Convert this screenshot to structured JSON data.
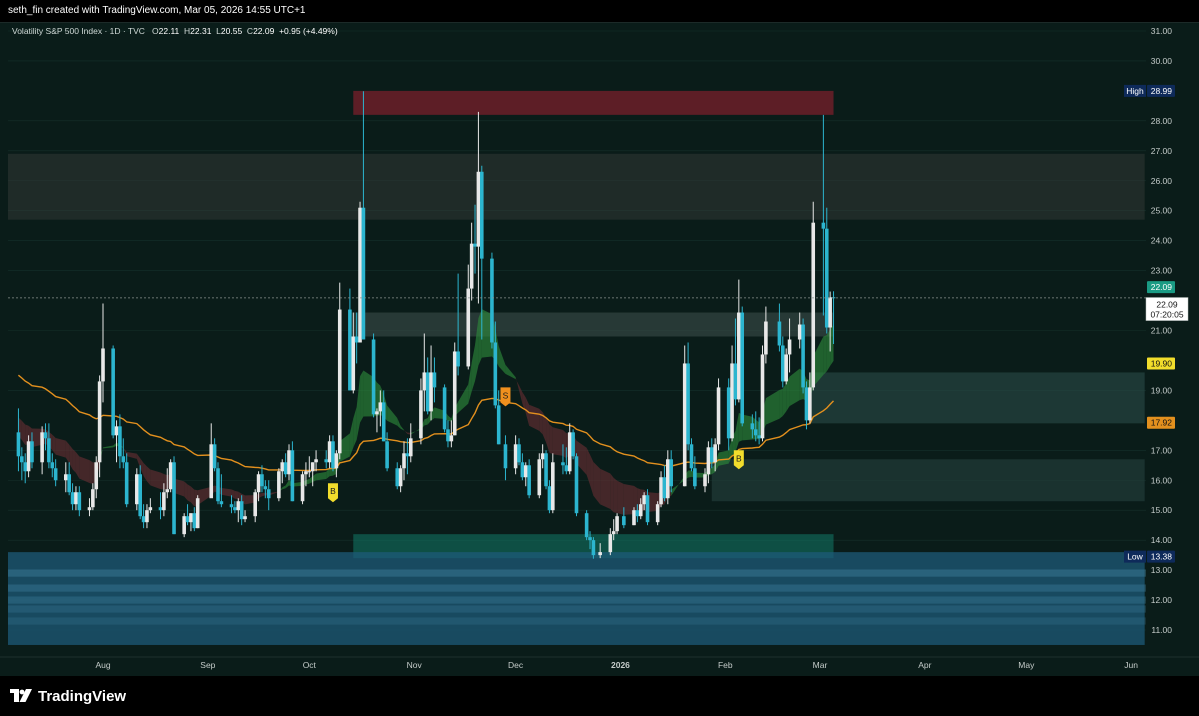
{
  "header": {
    "attribution": "seth_fin created with TradingView.com, Mar 05, 2026 14:55 UTC+1"
  },
  "legend": {
    "symbol": "Volatility S&P 500 Index · 1D · TVC",
    "o_label": "O",
    "o_value": "22.11",
    "h_label": "H",
    "h_value": "22.31",
    "l_label": "L",
    "l_value": "20.55",
    "c_label": "C",
    "c_value": "22.09",
    "change": "+0.95 (+4.49%)"
  },
  "branding": {
    "logo_text": "TradingView",
    "logo_icon": "tradingview-logo-icon"
  },
  "colors": {
    "background": "#0a1c19",
    "up_candle": "#e8e8e8",
    "down_candle": "#2cb5cf",
    "ema": "#e3901e",
    "grid": "#15302b"
  },
  "chart_data": {
    "type": "candlestick",
    "ylim": [
      10.5,
      31.5
    ],
    "y_ticks": [
      "31.00",
      "30.00",
      "28.00",
      "27.00",
      "26.00",
      "25.00",
      "24.00",
      "23.00",
      "21.00",
      "19.00",
      "17.00",
      "16.00",
      "15.00",
      "14.00",
      "13.00",
      "12.00",
      "11.00"
    ],
    "x_ticks": [
      "Aug",
      "Sep",
      "Oct",
      "Nov",
      "Dec",
      "2026",
      "Feb",
      "Mar",
      "Apr",
      "May",
      "Jun"
    ],
    "price_labels": {
      "high_label": "High",
      "high_value": "28.99",
      "low_label": "Low",
      "low_value": "13.38",
      "last_value": "22.09",
      "last_value_2": "22.09",
      "countdown": "07:20:05",
      "upper_band": "19.90",
      "ema_value": "17.92"
    },
    "signals": [
      {
        "text": "B",
        "x": "2025-10-08",
        "y": 15.6
      },
      {
        "text": "S",
        "x": "2025-11-28",
        "y": 18.8
      },
      {
        "text": "B",
        "x": "2026-02-05",
        "y": 16.7
      }
    ],
    "zones": [
      {
        "name": "supply-zone",
        "x_start": "2025-10-14",
        "x_end": "2026-03-05",
        "y_low": 28.2,
        "y_high": 29.0
      },
      {
        "name": "resistance-band",
        "x_start": "2025-06-24",
        "x_end": "2026-06-05",
        "y_low": 24.7,
        "y_high": 26.9
      },
      {
        "name": "mid-zone",
        "x_start": "2025-10-14",
        "x_end": "2026-03-05",
        "y_low": 20.8,
        "y_high": 21.6
      },
      {
        "name": "upper-demand-zone",
        "x_start": "2026-02-26",
        "x_end": "2026-06-05",
        "y_low": 17.9,
        "y_high": 19.6
      },
      {
        "name": "lower-demand-zone",
        "x_start": "2026-01-28",
        "x_end": "2026-06-05",
        "y_low": 15.3,
        "y_high": 16.7
      },
      {
        "name": "base-zone",
        "x_start": "2025-10-14",
        "x_end": "2026-03-05",
        "y_low": 13.4,
        "y_high": 14.2
      },
      {
        "name": "deep-band",
        "x_start": "2025-06-24",
        "x_end": "2026-06-05",
        "y_low": 10.5,
        "y_high": 13.6
      }
    ],
    "ohlc": [
      [
        "2025-07-07",
        17.6,
        18.4,
        16.3,
        16.8
      ],
      [
        "2025-07-08",
        16.8,
        17.1,
        16.0,
        16.6
      ],
      [
        "2025-07-09",
        16.6,
        16.9,
        15.9,
        16.3
      ],
      [
        "2025-07-10",
        16.3,
        17.5,
        16.1,
        17.3
      ],
      [
        "2025-07-11",
        17.3,
        17.6,
        16.4,
        16.6
      ],
      [
        "2025-07-14",
        16.6,
        17.8,
        16.2,
        17.6
      ],
      [
        "2025-07-15",
        17.6,
        17.9,
        17.0,
        17.4
      ],
      [
        "2025-07-16",
        17.4,
        17.9,
        16.4,
        16.6
      ],
      [
        "2025-07-17",
        16.6,
        16.9,
        16.1,
        16.4
      ],
      [
        "2025-07-18",
        16.4,
        16.7,
        15.8,
        16.0
      ],
      [
        "2025-07-21",
        16.0,
        16.6,
        15.6,
        16.2
      ],
      [
        "2025-07-22",
        16.2,
        16.6,
        15.5,
        15.6
      ],
      [
        "2025-07-23",
        15.6,
        15.9,
        15.0,
        15.2
      ],
      [
        "2025-07-24",
        15.2,
        15.8,
        15.0,
        15.6
      ],
      [
        "2025-07-25",
        15.6,
        15.8,
        14.8,
        15.0
      ],
      [
        "2025-07-28",
        15.0,
        15.4,
        14.8,
        15.1
      ],
      [
        "2025-07-29",
        15.1,
        15.9,
        15.0,
        15.7
      ],
      [
        "2025-07-30",
        15.7,
        16.8,
        15.4,
        16.6
      ],
      [
        "2025-07-31",
        16.6,
        19.5,
        16.1,
        19.3
      ],
      [
        "2025-08-01",
        19.3,
        21.9,
        18.6,
        20.4
      ],
      [
        "2025-08-04",
        20.4,
        20.5,
        17.4,
        17.5
      ],
      [
        "2025-08-05",
        17.5,
        18.0,
        16.6,
        17.8
      ],
      [
        "2025-08-06",
        17.8,
        18.2,
        16.4,
        16.8
      ],
      [
        "2025-08-07",
        16.8,
        17.4,
        16.4,
        16.6
      ],
      [
        "2025-08-08",
        16.6,
        16.9,
        15.1,
        15.2
      ],
      [
        "2025-08-11",
        15.2,
        16.4,
        15.0,
        16.2
      ],
      [
        "2025-08-12",
        16.2,
        16.5,
        14.7,
        14.8
      ],
      [
        "2025-08-13",
        14.8,
        15.2,
        14.4,
        14.6
      ],
      [
        "2025-08-14",
        14.6,
        15.2,
        14.4,
        15.0
      ],
      [
        "2025-08-15",
        15.0,
        15.4,
        14.9,
        15.1
      ],
      [
        "2025-08-18",
        15.1,
        15.6,
        14.7,
        15.0
      ],
      [
        "2025-08-19",
        15.0,
        15.9,
        14.8,
        15.6
      ],
      [
        "2025-08-20",
        15.6,
        16.4,
        15.4,
        15.7
      ],
      [
        "2025-08-21",
        15.7,
        16.7,
        15.6,
        16.6
      ],
      [
        "2025-08-22",
        16.6,
        16.8,
        14.2,
        14.2
      ],
      [
        "2025-08-25",
        14.2,
        14.9,
        14.1,
        14.8
      ],
      [
        "2025-08-26",
        14.8,
        15.2,
        14.5,
        14.6
      ],
      [
        "2025-08-27",
        14.6,
        14.9,
        14.3,
        14.9
      ],
      [
        "2025-08-28",
        14.9,
        15.1,
        14.3,
        14.4
      ],
      [
        "2025-08-29",
        14.4,
        15.5,
        14.4,
        15.4
      ],
      [
        "2025-09-02",
        15.4,
        17.9,
        15.8,
        17.2
      ],
      [
        "2025-09-03",
        17.2,
        17.4,
        16.3,
        16.4
      ],
      [
        "2025-09-04",
        16.4,
        16.6,
        15.2,
        15.3
      ],
      [
        "2025-09-05",
        15.3,
        16.2,
        15.1,
        15.2
      ],
      [
        "2025-09-08",
        15.2,
        15.5,
        14.9,
        15.1
      ],
      [
        "2025-09-09",
        15.1,
        15.3,
        14.9,
        15.0
      ],
      [
        "2025-09-10",
        15.0,
        15.4,
        14.6,
        15.3
      ],
      [
        "2025-09-11",
        15.3,
        15.5,
        14.5,
        14.7
      ],
      [
        "2025-09-12",
        14.7,
        15.0,
        14.6,
        14.8
      ],
      [
        "2025-09-15",
        14.8,
        15.7,
        14.6,
        15.6
      ],
      [
        "2025-09-16",
        15.6,
        16.3,
        15.3,
        16.2
      ],
      [
        "2025-09-17",
        16.2,
        16.5,
        15.6,
        15.8
      ],
      [
        "2025-09-18",
        15.8,
        16.0,
        15.4,
        15.7
      ],
      [
        "2025-09-19",
        15.7,
        16.0,
        15.0,
        15.4
      ],
      [
        "2025-09-22",
        15.4,
        16.4,
        15.3,
        16.3
      ],
      [
        "2025-09-23",
        16.3,
        16.7,
        15.9,
        16.6
      ],
      [
        "2025-09-24",
        16.6,
        16.9,
        16.1,
        16.2
      ],
      [
        "2025-09-25",
        16.2,
        17.2,
        16.0,
        17.0
      ],
      [
        "2025-09-26",
        17.0,
        17.3,
        15.3,
        15.3
      ],
      [
        "2025-09-29",
        15.3,
        16.3,
        15.2,
        16.2
      ],
      [
        "2025-09-30",
        16.2,
        16.6,
        15.8,
        16.3
      ],
      [
        "2025-10-01",
        16.3,
        16.8,
        16.1,
        16.3
      ],
      [
        "2025-10-02",
        16.3,
        16.6,
        15.8,
        16.6
      ],
      [
        "2025-10-03",
        16.6,
        17.0,
        16.3,
        16.7
      ],
      [
        "2025-10-06",
        16.7,
        17.0,
        16.4,
        16.6
      ],
      [
        "2025-10-07",
        16.6,
        17.5,
        16.4,
        17.3
      ],
      [
        "2025-10-08",
        17.3,
        17.5,
        16.3,
        16.4
      ],
      [
        "2025-10-09",
        16.4,
        17.0,
        16.1,
        16.9
      ],
      [
        "2025-10-10",
        16.9,
        22.6,
        16.7,
        21.7
      ],
      [
        "2025-10-13",
        21.7,
        22.4,
        19.0,
        19.0
      ],
      [
        "2025-10-14",
        19.0,
        21.6,
        18.9,
        20.8
      ],
      [
        "2025-10-15",
        20.8,
        21.6,
        19.9,
        20.6
      ],
      [
        "2025-10-16",
        20.6,
        25.3,
        20.6,
        25.1
      ],
      [
        "2025-10-17",
        25.1,
        28.99,
        20.7,
        20.7
      ],
      [
        "2025-10-20",
        20.7,
        20.9,
        18.1,
        18.2
      ],
      [
        "2025-10-21",
        18.2,
        18.4,
        17.6,
        18.3
      ],
      [
        "2025-10-22",
        18.3,
        19.0,
        17.8,
        18.6
      ],
      [
        "2025-10-23",
        18.6,
        19.0,
        17.3,
        17.3
      ],
      [
        "2025-10-24",
        17.3,
        17.6,
        16.3,
        16.4
      ],
      [
        "2025-10-27",
        16.4,
        16.6,
        15.7,
        15.8
      ],
      [
        "2025-10-28",
        15.8,
        16.5,
        15.6,
        16.4
      ],
      [
        "2025-10-29",
        16.4,
        17.3,
        16.0,
        16.9
      ],
      [
        "2025-10-30",
        16.9,
        17.4,
        16.2,
        16.8
      ],
      [
        "2025-10-31",
        16.8,
        17.9,
        16.6,
        17.4
      ],
      [
        "2025-11-03",
        17.4,
        19.4,
        17.2,
        19.0
      ],
      [
        "2025-11-04",
        19.0,
        20.9,
        18.3,
        19.6
      ],
      [
        "2025-11-05",
        19.6,
        20.1,
        18.2,
        18.3
      ],
      [
        "2025-11-06",
        18.3,
        20.5,
        18.0,
        19.6
      ],
      [
        "2025-11-07",
        19.6,
        20.1,
        18.6,
        19.1
      ],
      [
        "2025-11-10",
        19.1,
        19.2,
        17.6,
        17.7
      ],
      [
        "2025-11-11",
        17.7,
        18.0,
        17.1,
        17.3
      ],
      [
        "2025-11-12",
        17.3,
        18.0,
        17.1,
        17.5
      ],
      [
        "2025-11-13",
        17.5,
        20.6,
        17.5,
        20.3
      ],
      [
        "2025-11-14",
        20.3,
        22.9,
        19.5,
        19.8
      ],
      [
        "2025-11-17",
        19.8,
        23.2,
        19.7,
        22.4
      ],
      [
        "2025-11-18",
        22.4,
        24.6,
        22.0,
        23.9
      ],
      [
        "2025-11-19",
        23.9,
        25.2,
        22.9,
        23.8
      ],
      [
        "2025-11-20",
        23.8,
        28.3,
        21.9,
        26.3
      ],
      [
        "2025-11-21",
        26.3,
        26.5,
        20.7,
        23.4
      ],
      [
        "2025-11-24",
        23.4,
        23.6,
        20.4,
        20.6
      ],
      [
        "2025-11-25",
        20.6,
        21.3,
        18.4,
        18.5
      ],
      [
        "2025-11-26",
        18.5,
        19.0,
        17.2,
        17.2
      ],
      [
        "2025-11-28",
        17.2,
        17.5,
        16.0,
        16.4
      ],
      [
        "2025-12-01",
        16.4,
        17.5,
        16.2,
        17.2
      ],
      [
        "2025-12-02",
        17.2,
        17.4,
        16.5,
        16.6
      ],
      [
        "2025-12-03",
        16.6,
        16.9,
        16.0,
        16.1
      ],
      [
        "2025-12-04",
        16.1,
        16.6,
        15.8,
        16.5
      ],
      [
        "2025-12-05",
        16.5,
        16.7,
        15.4,
        15.5
      ],
      [
        "2025-12-08",
        15.5,
        16.9,
        15.4,
        16.7
      ],
      [
        "2025-12-09",
        16.7,
        17.2,
        16.4,
        16.9
      ],
      [
        "2025-12-10",
        16.9,
        17.0,
        15.7,
        15.8
      ],
      [
        "2025-12-11",
        15.8,
        16.0,
        14.9,
        15.0
      ],
      [
        "2025-12-12",
        15.0,
        16.9,
        14.9,
        16.6
      ],
      [
        "2025-12-15",
        16.6,
        17.2,
        16.2,
        16.5
      ],
      [
        "2025-12-16",
        16.5,
        17.1,
        16.2,
        16.3
      ],
      [
        "2025-12-17",
        16.3,
        17.9,
        16.2,
        17.6
      ],
      [
        "2025-12-18",
        17.6,
        17.7,
        16.7,
        16.8
      ],
      [
        "2025-12-19",
        16.8,
        16.9,
        14.8,
        14.9
      ],
      [
        "2025-12-22",
        14.9,
        15.0,
        14.0,
        14.1
      ],
      [
        "2025-12-23",
        14.1,
        14.3,
        13.7,
        14.0
      ],
      [
        "2025-12-24",
        14.0,
        14.1,
        13.38,
        13.5
      ],
      [
        "2025-12-26",
        13.5,
        13.9,
        13.4,
        13.6
      ],
      [
        "2025-12-29",
        13.6,
        14.4,
        13.5,
        14.2
      ],
      [
        "2025-12-30",
        14.2,
        14.7,
        14.0,
        14.3
      ],
      [
        "2025-12-31",
        14.3,
        14.9,
        14.2,
        14.8
      ],
      [
        "2026-01-02",
        14.8,
        15.1,
        14.4,
        14.5
      ],
      [
        "2026-01-05",
        14.5,
        15.1,
        14.5,
        15.0
      ],
      [
        "2026-01-06",
        15.0,
        15.2,
        14.6,
        14.8
      ],
      [
        "2026-01-07",
        14.8,
        15.4,
        14.7,
        15.2
      ],
      [
        "2026-01-08",
        15.2,
        15.6,
        15.0,
        15.5
      ],
      [
        "2026-01-09",
        15.5,
        15.7,
        14.5,
        14.6
      ],
      [
        "2026-01-12",
        14.6,
        15.3,
        14.5,
        15.2
      ],
      [
        "2026-01-13",
        15.2,
        16.3,
        15.1,
        16.1
      ],
      [
        "2026-01-14",
        16.1,
        16.5,
        15.3,
        15.4
      ],
      [
        "2026-01-15",
        15.4,
        17.0,
        15.2,
        16.7
      ],
      [
        "2026-01-16",
        16.7,
        17.0,
        15.6,
        15.8
      ],
      [
        "2026-01-20",
        15.8,
        20.5,
        15.8,
        19.9
      ],
      [
        "2026-01-21",
        19.9,
        20.6,
        17.0,
        17.2
      ],
      [
        "2026-01-22",
        17.2,
        17.4,
        16.3,
        16.4
      ],
      [
        "2026-01-23",
        16.4,
        16.8,
        15.7,
        15.8
      ],
      [
        "2026-01-26",
        15.8,
        16.4,
        15.6,
        16.2
      ],
      [
        "2026-01-27",
        16.2,
        17.3,
        15.9,
        17.1
      ],
      [
        "2026-01-28",
        17.1,
        17.4,
        16.4,
        16.6
      ],
      [
        "2026-01-29",
        16.6,
        17.4,
        16.3,
        17.2
      ],
      [
        "2026-01-30",
        17.2,
        19.4,
        17.0,
        19.1
      ],
      [
        "2026-02-02",
        19.1,
        19.4,
        17.0,
        17.4
      ],
      [
        "2026-02-03",
        17.4,
        20.5,
        17.3,
        19.9
      ],
      [
        "2026-02-04",
        19.9,
        21.4,
        18.5,
        18.7
      ],
      [
        "2026-02-05",
        18.7,
        22.7,
        18.6,
        21.6
      ],
      [
        "2026-02-06",
        21.6,
        21.8,
        17.8,
        17.9
      ],
      [
        "2026-02-09",
        17.9,
        18.2,
        17.4,
        17.7
      ],
      [
        "2026-02-10",
        17.7,
        18.3,
        17.3,
        17.5
      ],
      [
        "2026-02-11",
        17.5,
        18.1,
        17.2,
        17.4
      ],
      [
        "2026-02-12",
        17.4,
        20.5,
        17.3,
        20.2
      ],
      [
        "2026-02-13",
        20.2,
        21.8,
        19.9,
        21.3
      ],
      [
        "2026-02-17",
        21.3,
        21.9,
        20.3,
        20.5
      ],
      [
        "2026-02-18",
        20.5,
        20.8,
        19.1,
        19.3
      ],
      [
        "2026-02-19",
        19.3,
        20.4,
        19.2,
        20.2
      ],
      [
        "2026-02-20",
        20.2,
        21.4,
        19.6,
        20.7
      ],
      [
        "2026-02-23",
        20.7,
        21.6,
        20.4,
        21.2
      ],
      [
        "2026-02-24",
        21.2,
        21.4,
        18.9,
        19.1
      ],
      [
        "2026-02-25",
        19.1,
        19.3,
        17.7,
        18.0
      ],
      [
        "2026-02-26",
        18.0,
        19.6,
        17.9,
        19.1
      ],
      [
        "2026-02-27",
        19.1,
        25.3,
        19.0,
        24.6
      ],
      [
        "2026-03-02",
        24.6,
        28.2,
        21.5,
        24.4
      ],
      [
        "2026-03-03",
        24.4,
        25.1,
        20.9,
        21.1
      ],
      [
        "2026-03-04",
        21.1,
        22.3,
        20.3,
        22.11
      ],
      [
        "2026-03-05",
        22.11,
        22.31,
        20.55,
        22.09
      ]
    ],
    "ema_value_last": 17.92
  }
}
